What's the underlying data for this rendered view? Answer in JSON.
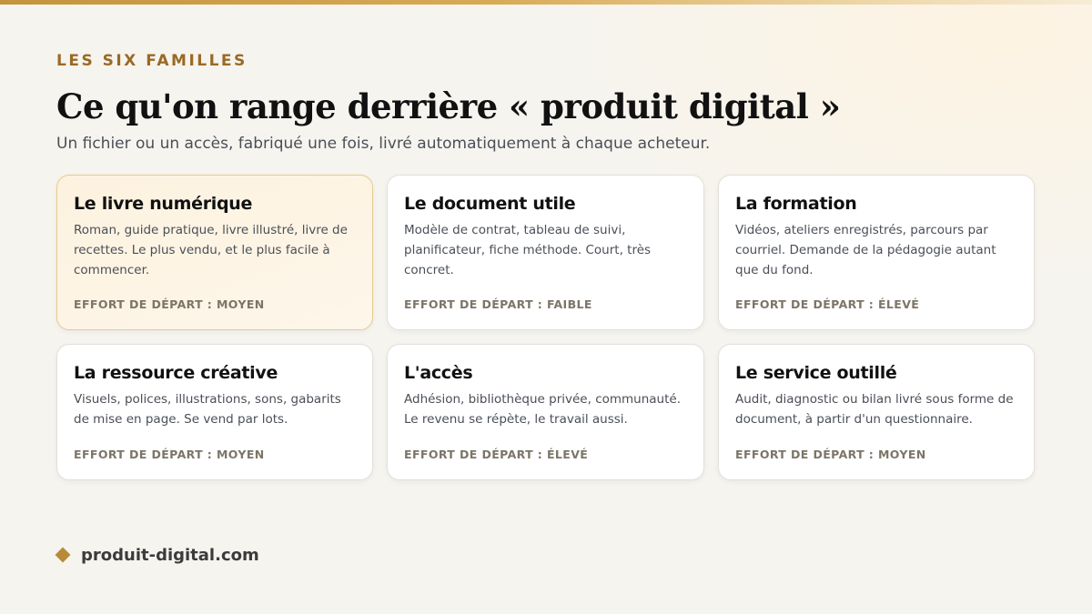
{
  "header": {
    "eyebrow": "LES SIX FAMILLES",
    "title": "Ce qu'on range derrière « produit digital »",
    "subtitle": "Un fichier ou un accès, fabriqué une fois, livré automatiquement à chaque acheteur."
  },
  "cards": [
    {
      "title": "Le livre numérique",
      "description": "Roman, guide pratique, livre illustré, livre de recettes. Le plus vendu, et le plus facile à commencer.",
      "effort": "EFFORT DE DÉPART : MOYEN",
      "highlighted": true
    },
    {
      "title": "Le document utile",
      "description": "Modèle de contrat, tableau de suivi, planificateur, fiche méthode. Court, très concret.",
      "effort": "EFFORT DE DÉPART : FAIBLE"
    },
    {
      "title": "La formation",
      "description": "Vidéos, ateliers enregistrés, parcours par courriel. Demande de la pédagogie autant que du fond.",
      "effort": "EFFORT DE DÉPART : ÉLEVÉ"
    },
    {
      "title": "La ressource créative",
      "description": "Visuels, polices, illustrations, sons, gabarits de mise en page. Se vend par lots.",
      "effort": "EFFORT DE DÉPART : MOYEN"
    },
    {
      "title": "L'accès",
      "description": "Adhésion, bibliothèque privée, communauté. Le revenu se répète, le travail aussi.",
      "effort": "EFFORT DE DÉPART : ÉLEVÉ"
    },
    {
      "title": "Le service outillé",
      "description": "Audit, diagnostic ou bilan livré sous forme de document, à partir d'un questionnaire.",
      "effort": "EFFORT DE DÉPART : MOYEN"
    }
  ],
  "footer": {
    "icon": "diamond-icon",
    "site": "produit-digital.com"
  },
  "colors": {
    "accent": "#b88a3a",
    "eyebrow": "#9a6a24",
    "highlight_bg": "#fdf2df",
    "highlight_border": "#e8c98d"
  }
}
